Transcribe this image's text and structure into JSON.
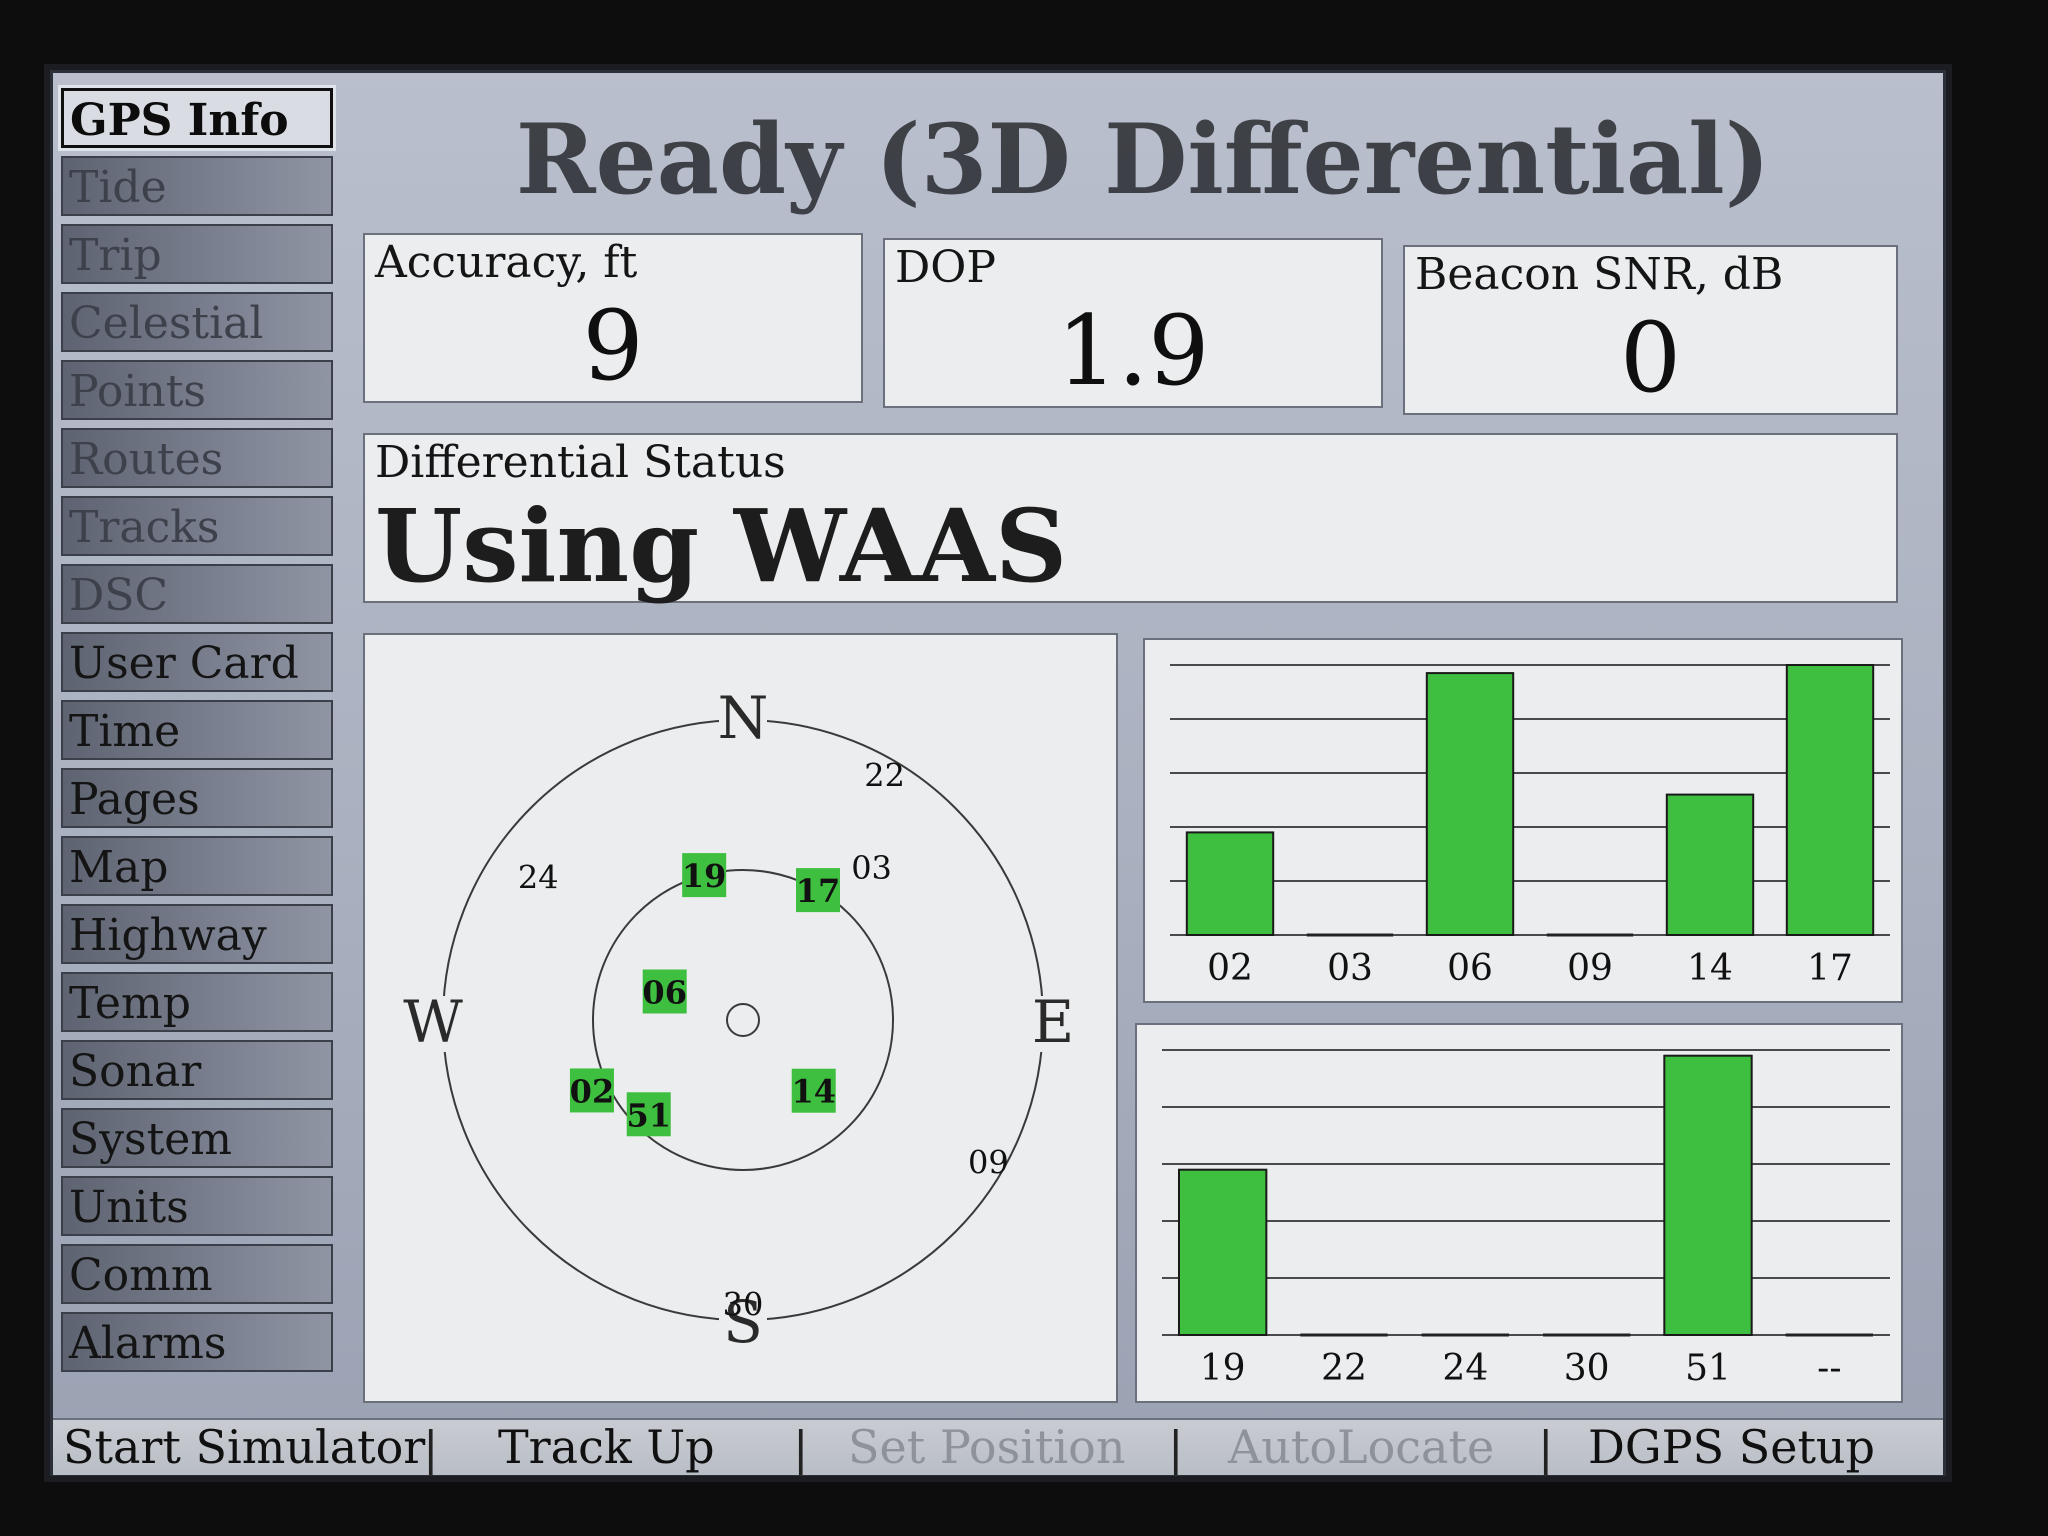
{
  "title": "Ready (3D Differential)",
  "sidebar": {
    "items": [
      {
        "label": "GPS Info",
        "state": "active"
      },
      {
        "label": "Tide",
        "state": "dim"
      },
      {
        "label": "Trip",
        "state": "dim"
      },
      {
        "label": "Celestial",
        "state": "dim"
      },
      {
        "label": "Points",
        "state": "dim"
      },
      {
        "label": "Routes",
        "state": "dim"
      },
      {
        "label": "Tracks",
        "state": "dim"
      },
      {
        "label": "DSC",
        "state": "dim"
      },
      {
        "label": "User Card",
        "state": "normal"
      },
      {
        "label": "Time",
        "state": "normal"
      },
      {
        "label": "Pages",
        "state": "normal"
      },
      {
        "label": "Map",
        "state": "normal"
      },
      {
        "label": "Highway",
        "state": "normal"
      },
      {
        "label": "Temp",
        "state": "normal"
      },
      {
        "label": "Sonar",
        "state": "normal"
      },
      {
        "label": "System",
        "state": "normal"
      },
      {
        "label": "Units",
        "state": "normal"
      },
      {
        "label": "Comm",
        "state": "normal"
      },
      {
        "label": "Alarms",
        "state": "normal"
      }
    ]
  },
  "fields": {
    "accuracy": {
      "label": "Accuracy, ft",
      "value": "9"
    },
    "dop": {
      "label": "DOP",
      "value": "1.9"
    },
    "beacon_snr": {
      "label": "Beacon SNR, dB",
      "value": "0"
    },
    "differential": {
      "label": "Differential Status",
      "value": "Using WAAS"
    }
  },
  "sky": {
    "cardinals": {
      "n": "N",
      "e": "E",
      "s": "S",
      "w": "W"
    },
    "satellites_locked": [
      {
        "id": "19",
        "azimuth": 345,
        "elevation": 45
      },
      {
        "id": "17",
        "azimuth": 30,
        "elevation": 45
      },
      {
        "id": "06",
        "azimuth": 290,
        "elevation": 65
      },
      {
        "id": "02",
        "azimuth": 245,
        "elevation": 40
      },
      {
        "id": "51",
        "azimuth": 225,
        "elevation": 50
      },
      {
        "id": "14",
        "azimuth": 135,
        "elevation": 60
      }
    ],
    "satellites_visible": [
      {
        "id": "22",
        "azimuth": 30,
        "elevation": 5
      },
      {
        "id": "03",
        "azimuth": 40,
        "elevation": 30
      },
      {
        "id": "24",
        "azimuth": 305,
        "elevation": 15
      },
      {
        "id": "09",
        "azimuth": 120,
        "elevation": 5
      },
      {
        "id": "30",
        "azimuth": 180,
        "elevation": 5
      }
    ],
    "colors": {
      "locked": "#3fbf3f",
      "ring": "#3a3a3a"
    }
  },
  "signal_bars": {
    "top": [
      {
        "id": "02",
        "strength": 0.38
      },
      {
        "id": "03",
        "strength": 0.0
      },
      {
        "id": "06",
        "strength": 0.97
      },
      {
        "id": "09",
        "strength": 0.0
      },
      {
        "id": "14",
        "strength": 0.52
      },
      {
        "id": "17",
        "strength": 1.0
      }
    ],
    "bottom": [
      {
        "id": "19",
        "strength": 0.58
      },
      {
        "id": "22",
        "strength": 0.0
      },
      {
        "id": "24",
        "strength": 0.0
      },
      {
        "id": "30",
        "strength": 0.0
      },
      {
        "id": "51",
        "strength": 0.98
      },
      {
        "id": "--",
        "strength": 0.0
      }
    ],
    "color": "#3fbf3f"
  },
  "softkeys": [
    {
      "label": "Start Simulator",
      "enabled": true
    },
    {
      "label": "Track Up",
      "enabled": true
    },
    {
      "label": "Set Position",
      "enabled": false
    },
    {
      "label": "AutoLocate",
      "enabled": false
    },
    {
      "label": "DGPS Setup",
      "enabled": true
    }
  ]
}
